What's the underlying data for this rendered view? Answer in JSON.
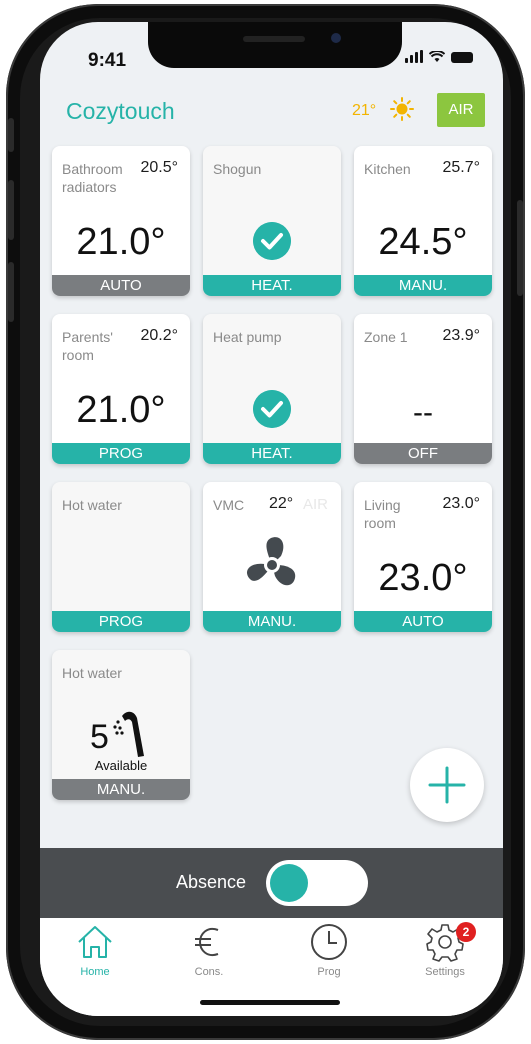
{
  "status_bar": {
    "time": "9:41"
  },
  "header": {
    "title": "Cozytouch",
    "outdoor_temp": "21°",
    "weather_icon": "sun-icon",
    "air_label": "AIR"
  },
  "tiles": [
    {
      "name": "Bathroom radiators",
      "current": "20.5°",
      "target": "21.0°",
      "mode": "AUTO",
      "mode_color": "#7a7d80"
    },
    {
      "name": "Shogun",
      "current": "",
      "target": "",
      "mode": "HEAT.",
      "mode_color": "#26b3a8",
      "icon": "check-icon"
    },
    {
      "name": "Kitchen",
      "current": "25.7°",
      "target": "24.5°",
      "mode": "MANU.",
      "mode_color": "#26b3a8"
    },
    {
      "name": "Parents' room",
      "current": "20.2°",
      "target": "21.0°",
      "mode": "PROG",
      "mode_color": "#26b3a8"
    },
    {
      "name": "Heat pump",
      "current": "",
      "target": "",
      "mode": "HEAT.",
      "mode_color": "#26b3a8",
      "icon": "check-icon"
    },
    {
      "name": "Zone 1",
      "current": "23.9°",
      "target": "--",
      "mode": "OFF",
      "mode_color": "#7a7d80"
    },
    {
      "name": "Hot water",
      "current": "",
      "target": "",
      "mode": "PROG",
      "mode_color": "#26b3a8"
    },
    {
      "name": "VMC",
      "current": "22°",
      "air": "AIR",
      "target": "",
      "mode": "MANU.",
      "mode_color": "#26b3a8",
      "icon": "fan-icon"
    },
    {
      "name": "Living room",
      "current": "23.0°",
      "target": "23.0°",
      "mode": "AUTO",
      "mode_color": "#26b3a8"
    },
    {
      "name": "Hot water",
      "current": "",
      "count": "5",
      "available": "Available",
      "mode": "MANU.",
      "mode_color": "#7a7d80",
      "icon": "shower-icon"
    }
  ],
  "fab": {
    "icon": "plus-icon"
  },
  "absence": {
    "label": "Absence",
    "enabled": true
  },
  "tabbar": {
    "items": [
      {
        "label": "Home",
        "icon": "home-icon",
        "active": true
      },
      {
        "label": "Cons.",
        "icon": "euro-icon",
        "active": false
      },
      {
        "label": "Prog",
        "icon": "clock-icon",
        "active": false
      },
      {
        "label": "Settings",
        "icon": "gear-icon",
        "active": false,
        "badge": "2"
      }
    ]
  },
  "colors": {
    "accent": "#26b3a8",
    "air_badge": "#8cc63f",
    "sun": "#f2b400",
    "mode_off": "#7a7d80",
    "badge": "#e02020"
  }
}
